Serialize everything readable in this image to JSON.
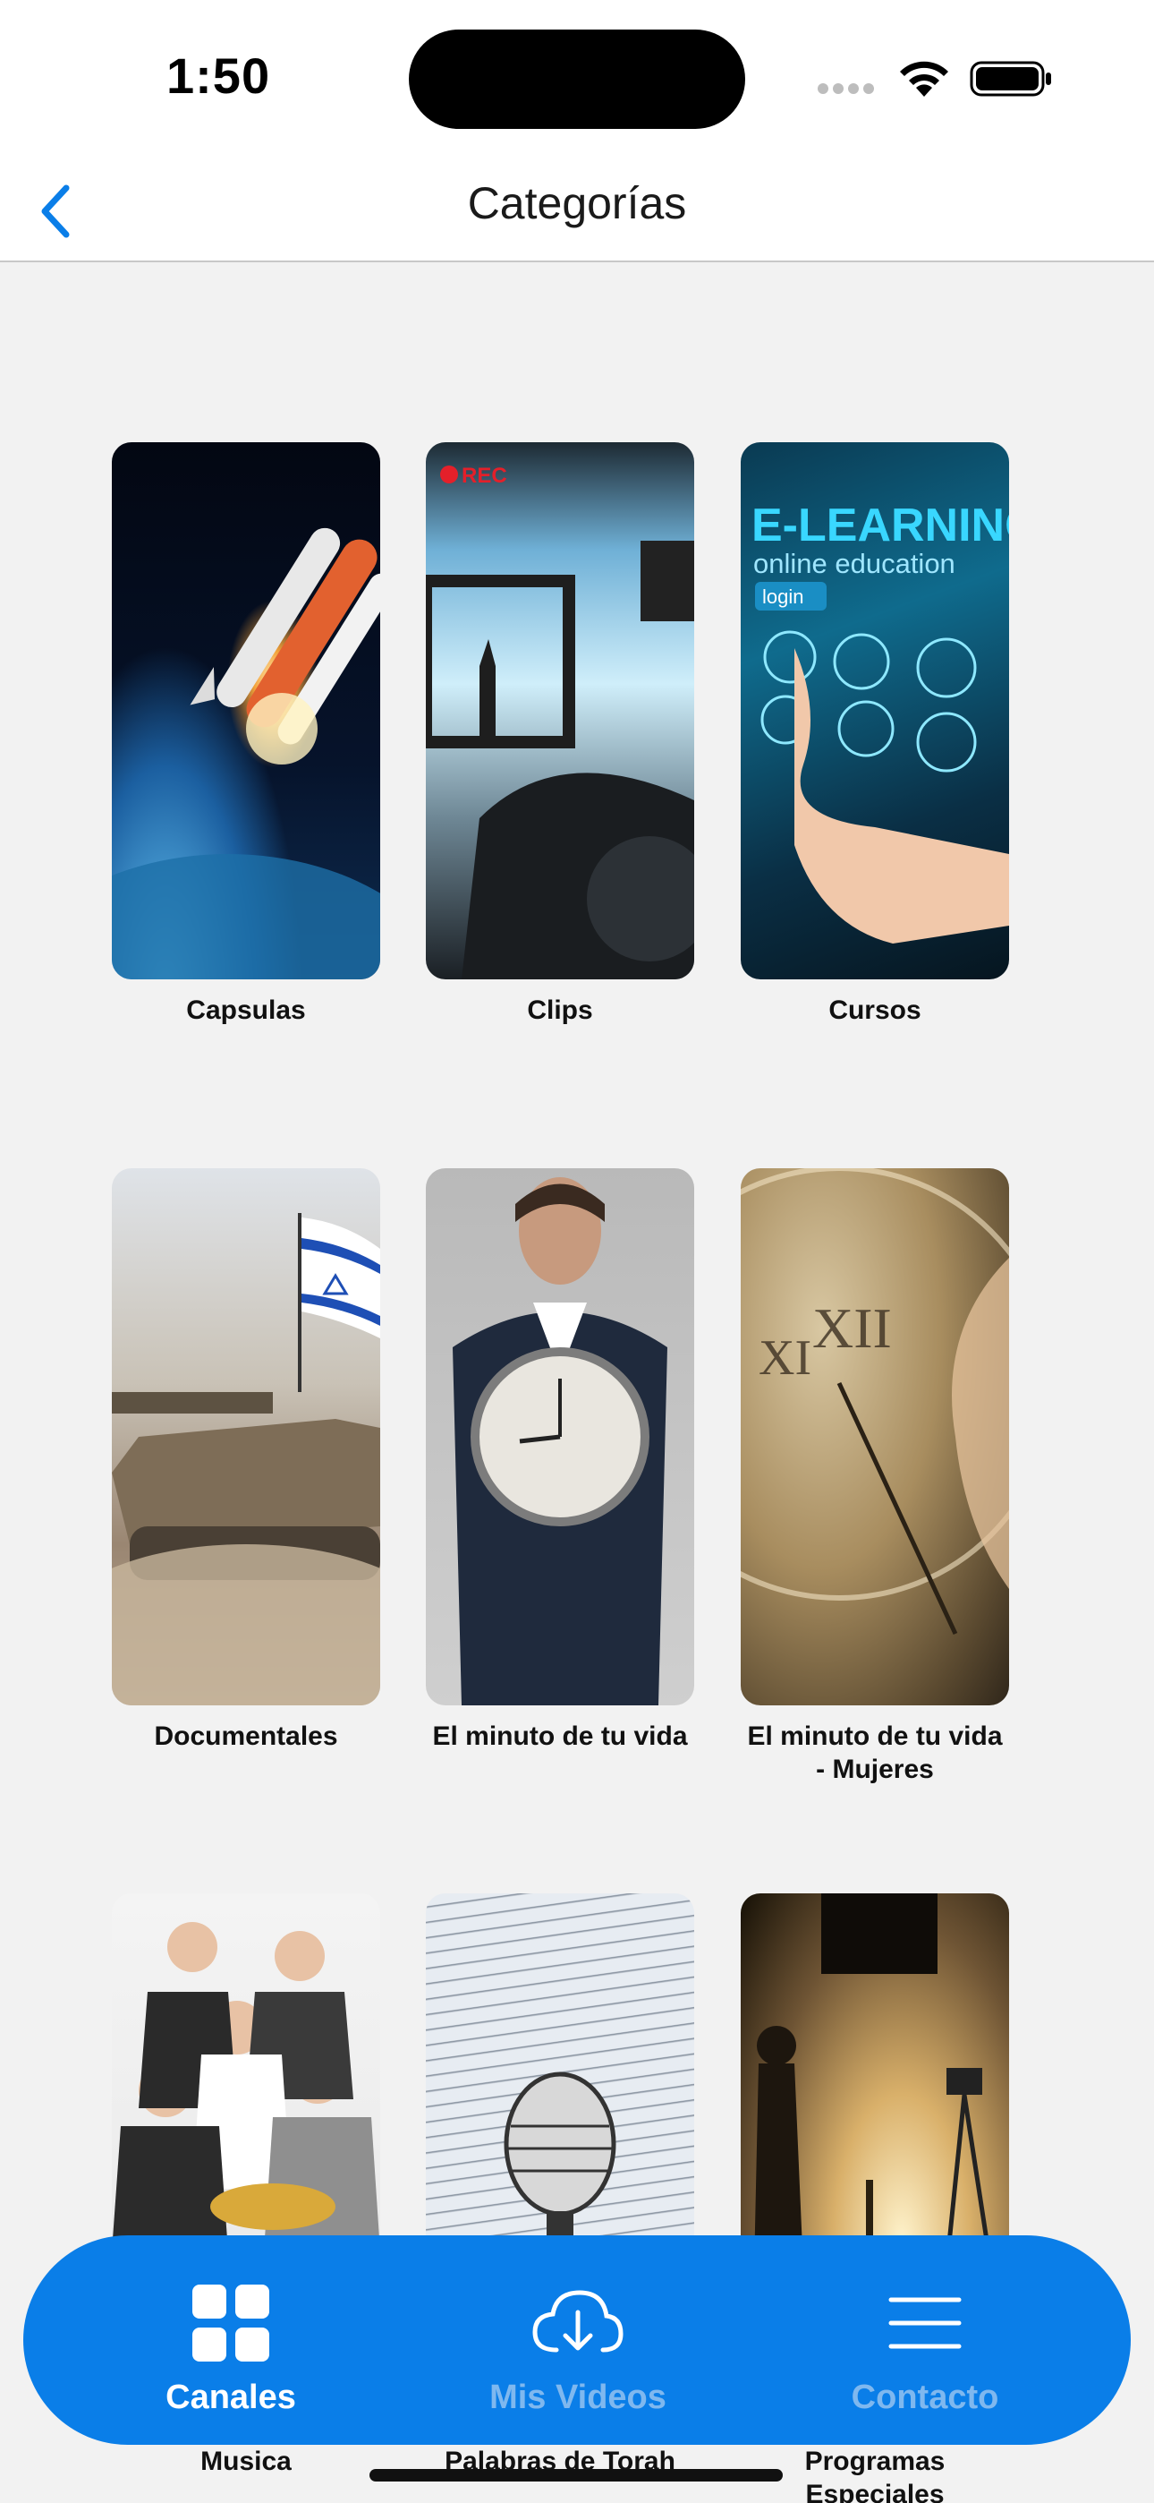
{
  "status_bar": {
    "time": "1:50"
  },
  "nav": {
    "title": "Categorías",
    "back_icon": "chevron-left-icon"
  },
  "categories": [
    {
      "label": "Capsulas"
    },
    {
      "label": "Clips",
      "rec_badge": "REC"
    },
    {
      "label": "Cursos",
      "overlay_title": "E-LEARNING",
      "overlay_subtitle": "online education",
      "overlay_button": "login"
    },
    {
      "label": "Documentales"
    },
    {
      "label": "El minuto de tu vida"
    },
    {
      "label": "El minuto de tu vida - Mujeres"
    },
    {
      "label": "Musica"
    },
    {
      "label": "Palabras de Torah"
    },
    {
      "label": "Programas Especiales"
    }
  ],
  "tab_bar": {
    "tabs": [
      {
        "label": "Canales",
        "icon": "grid-icon",
        "active": true
      },
      {
        "label": "Mis Videos",
        "icon": "cloud-download-icon",
        "active": false
      },
      {
        "label": "Contacto",
        "icon": "menu-icon",
        "active": false
      }
    ]
  },
  "colors": {
    "accent": "#0a7ee8",
    "inactive_tab": "#7fb8ef",
    "background": "#f2f2f2"
  }
}
